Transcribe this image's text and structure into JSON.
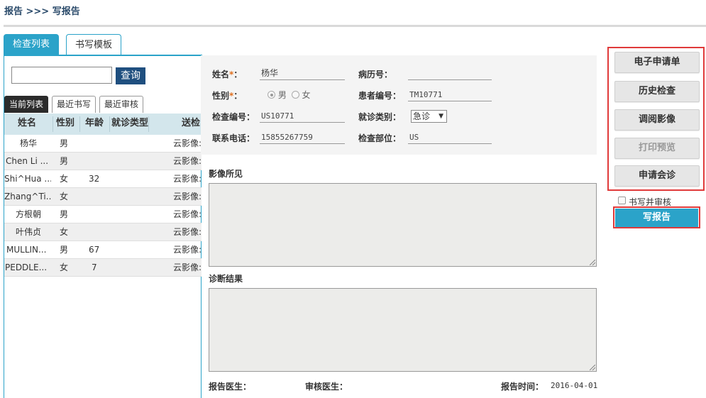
{
  "breadcrumb": "报告 >>> 写报告",
  "tabs": {
    "active": "检查列表",
    "inactive": "书写模板"
  },
  "search": {
    "value": "",
    "button": "查询"
  },
  "subtabs": [
    "当前列表",
    "最近书写",
    "最近审核"
  ],
  "table": {
    "headers": [
      "姓名",
      "性别",
      "年龄",
      "就诊类型",
      "送检"
    ],
    "rows": [
      {
        "name": "杨华",
        "sex": "男",
        "age": "",
        "type": "",
        "send": "云影像:"
      },
      {
        "name": "Chen Li ...",
        "sex": "男",
        "age": "",
        "type": "",
        "send": "云影像:"
      },
      {
        "name": "Shi^Hua ...",
        "sex": "女",
        "age": "32",
        "type": "",
        "send": "云影像:"
      },
      {
        "name": "Zhang^Ti...",
        "sex": "女",
        "age": "",
        "type": "",
        "send": "云影像:"
      },
      {
        "name": "方根朝",
        "sex": "男",
        "age": "",
        "type": "",
        "send": "云影像:"
      },
      {
        "name": "叶伟贞",
        "sex": "女",
        "age": "",
        "type": "",
        "send": "云影像:"
      },
      {
        "name": "MULLIN...",
        "sex": "男",
        "age": "67",
        "type": "",
        "send": "云影像:"
      },
      {
        "name": "PEDDLE...",
        "sex": "女",
        "age": "7",
        "type": "",
        "send": "云影像:"
      }
    ]
  },
  "patient": {
    "name_label": "姓名",
    "name": "杨华",
    "record_label": "病历号：",
    "record": "",
    "sex_label": "性别",
    "sex_male": "男",
    "sex_female": "女",
    "patient_no_label": "患者编号：",
    "patient_no": "TM10771",
    "exam_no_label": "检查编号：",
    "exam_no": "US10771",
    "visit_type_label": "就诊类别：",
    "visit_type": "急诊",
    "phone_label": "联系电话：",
    "phone": "15855267759",
    "part_label": "检查部位：",
    "part": "US",
    "required_mark": "*",
    "colon": "："
  },
  "sections": {
    "findings": "影像所见",
    "diagnosis": "诊断结果"
  },
  "footer": {
    "doctor_label": "报告医生：",
    "reviewer_label": "审核医生：",
    "time_label": "报告时间：",
    "time": "2016-04-01"
  },
  "actions": {
    "e_request": "电子申请单",
    "history": "历史检查",
    "view_image": "调阅影像",
    "print_preview": "打印预览",
    "consult": "申请会诊",
    "write_review": "书写并审核",
    "write_report": "写报告"
  },
  "colors": {
    "accent": "#2ba3c9",
    "highlight_border": "#e03a3a",
    "dark_button": "#1f4f7f"
  }
}
